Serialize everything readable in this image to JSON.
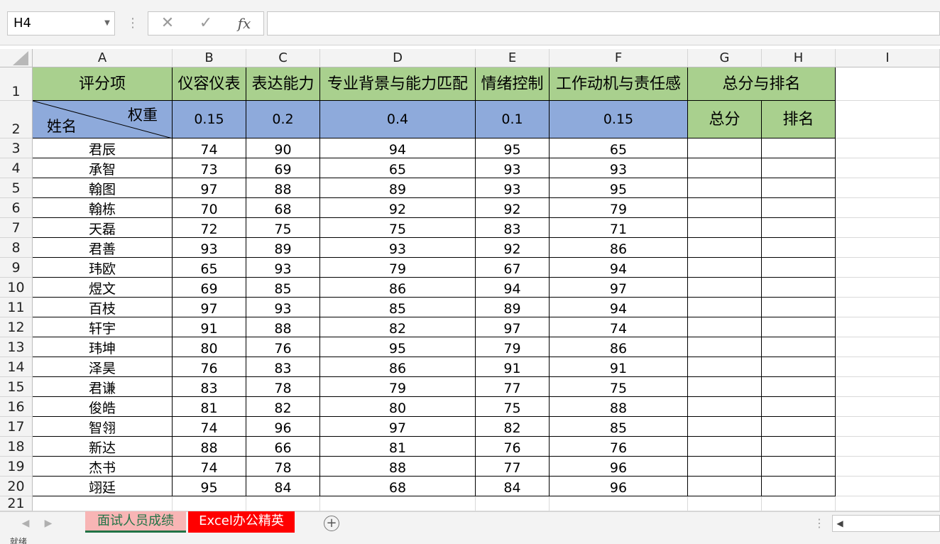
{
  "formula_bar": {
    "name_box": "H4",
    "cancel_glyph": "✕",
    "enter_glyph": "✓",
    "fx_label": "fx",
    "formula_value": ""
  },
  "columns": [
    "A",
    "B",
    "C",
    "D",
    "E",
    "F",
    "G",
    "H",
    "I"
  ],
  "rows": [
    "1",
    "2",
    "3",
    "4",
    "5",
    "6",
    "7",
    "8",
    "9",
    "10",
    "11",
    "12",
    "13",
    "14",
    "15",
    "16",
    "17",
    "18",
    "19",
    "20",
    "21"
  ],
  "table": {
    "header_row1": {
      "a1": "评分项",
      "b1": "仪容仪表",
      "c1": "表达能力",
      "d1": "专业背景与能力匹配",
      "e1": "情绪控制",
      "f1": "工作动机与责任感",
      "gh1": "总分与排名"
    },
    "header_row2": {
      "a2_top": "权重",
      "a2_bottom": "姓名",
      "b2": "0.15",
      "c2": "0.2",
      "d2": "0.4",
      "e2": "0.1",
      "f2": "0.15",
      "g2": "总分",
      "h2": "排名"
    },
    "data_rows": [
      {
        "name": "君辰",
        "b": "74",
        "c": "90",
        "d": "94",
        "e": "95",
        "f": "65",
        "g": "",
        "h": ""
      },
      {
        "name": "承智",
        "b": "73",
        "c": "69",
        "d": "65",
        "e": "93",
        "f": "93",
        "g": "",
        "h": ""
      },
      {
        "name": "翰图",
        "b": "97",
        "c": "88",
        "d": "89",
        "e": "93",
        "f": "95",
        "g": "",
        "h": ""
      },
      {
        "name": "翰栋",
        "b": "70",
        "c": "68",
        "d": "92",
        "e": "92",
        "f": "79",
        "g": "",
        "h": ""
      },
      {
        "name": "天磊",
        "b": "72",
        "c": "75",
        "d": "75",
        "e": "83",
        "f": "71",
        "g": "",
        "h": ""
      },
      {
        "name": "君善",
        "b": "93",
        "c": "89",
        "d": "93",
        "e": "92",
        "f": "86",
        "g": "",
        "h": ""
      },
      {
        "name": "玮欧",
        "b": "65",
        "c": "93",
        "d": "79",
        "e": "67",
        "f": "94",
        "g": "",
        "h": ""
      },
      {
        "name": "煜文",
        "b": "69",
        "c": "85",
        "d": "86",
        "e": "94",
        "f": "97",
        "g": "",
        "h": ""
      },
      {
        "name": "百枝",
        "b": "97",
        "c": "93",
        "d": "85",
        "e": "89",
        "f": "94",
        "g": "",
        "h": ""
      },
      {
        "name": "轩宇",
        "b": "91",
        "c": "88",
        "d": "82",
        "e": "97",
        "f": "74",
        "g": "",
        "h": ""
      },
      {
        "name": "玮坤",
        "b": "80",
        "c": "76",
        "d": "95",
        "e": "79",
        "f": "86",
        "g": "",
        "h": ""
      },
      {
        "name": "泽昊",
        "b": "76",
        "c": "83",
        "d": "86",
        "e": "91",
        "f": "91",
        "g": "",
        "h": ""
      },
      {
        "name": "君谦",
        "b": "83",
        "c": "78",
        "d": "79",
        "e": "77",
        "f": "75",
        "g": "",
        "h": ""
      },
      {
        "name": "俊皓",
        "b": "81",
        "c": "82",
        "d": "80",
        "e": "75",
        "f": "88",
        "g": "",
        "h": ""
      },
      {
        "name": "智翎",
        "b": "74",
        "c": "96",
        "d": "97",
        "e": "82",
        "f": "85",
        "g": "",
        "h": ""
      },
      {
        "name": "新达",
        "b": "88",
        "c": "66",
        "d": "81",
        "e": "76",
        "f": "76",
        "g": "",
        "h": ""
      },
      {
        "name": "杰书",
        "b": "74",
        "c": "78",
        "d": "88",
        "e": "77",
        "f": "96",
        "g": "",
        "h": ""
      },
      {
        "name": "翊廷",
        "b": "95",
        "c": "84",
        "d": "68",
        "e": "84",
        "f": "96",
        "g": "",
        "h": ""
      }
    ]
  },
  "sheet_tabs": [
    "面试人员成绩",
    "Excel办公精英"
  ],
  "add_sheet_glyph": "+",
  "status_text": "就绪",
  "colors": {
    "header_green": "#a9d08e",
    "weight_blue": "#8eaadb",
    "tab_active_bg": "#f8b5b5",
    "tab_active_text": "#217346",
    "tab2_bg": "#ff0000"
  }
}
